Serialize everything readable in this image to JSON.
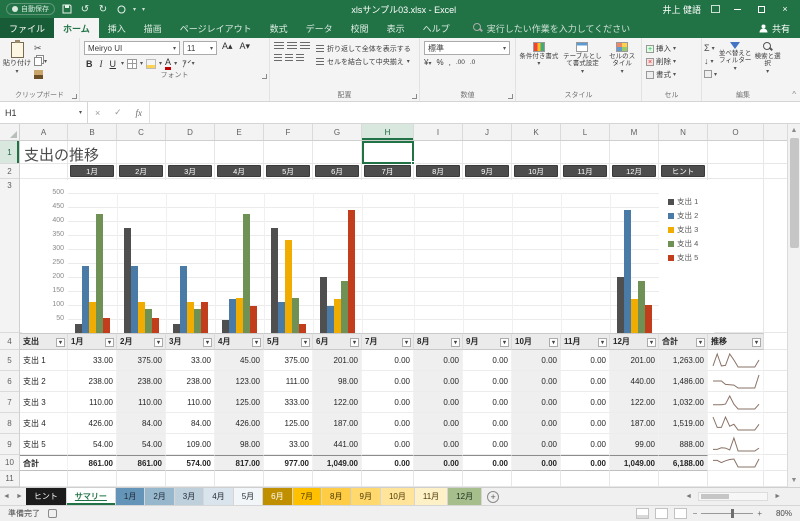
{
  "colors": {
    "accent": "#217346",
    "slicer": "#4d4d4d",
    "sparkline": "#8a7265"
  },
  "titlebar": {
    "autosave": "自動保存",
    "title": "xlsサンプル03.xlsx - Excel",
    "user": "井上 健語"
  },
  "ribbon": {
    "tabs": [
      "ファイル",
      "ホーム",
      "挿入",
      "描画",
      "ページレイアウト",
      "数式",
      "データ",
      "校閲",
      "表示",
      "ヘルプ"
    ],
    "active_tab": "ホーム",
    "search_label": "実行したい作業を入力してください",
    "share_label": "共有",
    "clipboard": {
      "paste": "貼り付け",
      "label": "クリップボード"
    },
    "font": {
      "name": "Meiryo UI",
      "size": "11",
      "label": "フォント"
    },
    "alignment": {
      "wrap": "折り返して全体を表示する",
      "merge": "セルを結合して中央揃え",
      "label": "配置"
    },
    "number": {
      "format": "標準",
      "label": "数値"
    },
    "styles": {
      "conditional": "条件付き書式",
      "table": "テーブルとして書式設定",
      "cell": "セルのスタイル",
      "label": "スタイル"
    },
    "cells": {
      "insert": "挿入",
      "delete": "削除",
      "format": "書式",
      "label": "セル"
    },
    "editing": {
      "sort": "並べ替えとフィルター",
      "find": "検索と選択",
      "label": "編集"
    }
  },
  "formula_bar": {
    "name_box": "H1",
    "formula": ""
  },
  "grid": {
    "columns": [
      "A",
      "B",
      "C",
      "D",
      "E",
      "F",
      "G",
      "H",
      "I",
      "J",
      "K",
      "L",
      "M",
      "N",
      "O"
    ],
    "selected_column": "H",
    "selected_cell": "H1",
    "rows": [
      "1",
      "2",
      "3",
      "4",
      "5",
      "6",
      "7",
      "8",
      "9",
      "10",
      "11"
    ]
  },
  "sheet": {
    "title": "支出の推移",
    "slicer_buttons": [
      "1月",
      "2月",
      "3月",
      "4月",
      "5月",
      "6月",
      "7月",
      "8月",
      "9月",
      "10月",
      "11月",
      "12月",
      "ヒント"
    ]
  },
  "chart_data": {
    "type": "bar",
    "title": "支出の推移",
    "categories": [
      "1月",
      "2月",
      "3月",
      "4月",
      "5月",
      "6月",
      "7月",
      "8月",
      "9月",
      "10月",
      "11月",
      "12月"
    ],
    "series": [
      {
        "name": "支出 1",
        "color": "#4f4f4f",
        "values": [
          33,
          375,
          33,
          45,
          375,
          201,
          0,
          0,
          0,
          0,
          0,
          201
        ]
      },
      {
        "name": "支出 2",
        "color": "#4a7ba7",
        "values": [
          238,
          238,
          238,
          123,
          111,
          98,
          0,
          0,
          0,
          0,
          0,
          440
        ]
      },
      {
        "name": "支出 3",
        "color": "#f0ac00",
        "values": [
          110,
          110,
          110,
          125,
          333,
          122,
          0,
          0,
          0,
          0,
          0,
          122
        ]
      },
      {
        "name": "支出 4",
        "color": "#6f9155",
        "values": [
          426,
          84,
          84,
          426,
          125,
          187,
          0,
          0,
          0,
          0,
          0,
          187
        ]
      },
      {
        "name": "支出 5",
        "color": "#c23d1b",
        "values": [
          54,
          54,
          109,
          98,
          33,
          441,
          0,
          0,
          0,
          0,
          0,
          99
        ]
      }
    ],
    "ylim": [
      0,
      500
    ],
    "yticks": [
      50,
      100,
      150,
      200,
      250,
      300,
      350,
      400,
      450,
      500
    ],
    "grid": true,
    "legend_position": "right"
  },
  "table": {
    "header": [
      "支出",
      "1月",
      "2月",
      "3月",
      "4月",
      "5月",
      "6月",
      "7月",
      "8月",
      "9月",
      "10月",
      "11月",
      "12月",
      "合計",
      "推移"
    ],
    "rows": [
      {
        "label": "支出 1",
        "cells": [
          "33.00",
          "375.00",
          "33.00",
          "45.00",
          "375.00",
          "201.00",
          "0.00",
          "0.00",
          "0.00",
          "0.00",
          "0.00",
          "201.00"
        ],
        "total": "1,263.00"
      },
      {
        "label": "支出 2",
        "cells": [
          "238.00",
          "238.00",
          "238.00",
          "123.00",
          "111.00",
          "98.00",
          "0.00",
          "0.00",
          "0.00",
          "0.00",
          "0.00",
          "440.00"
        ],
        "total": "1,486.00"
      },
      {
        "label": "支出 3",
        "cells": [
          "110.00",
          "110.00",
          "110.00",
          "125.00",
          "333.00",
          "122.00",
          "0.00",
          "0.00",
          "0.00",
          "0.00",
          "0.00",
          "122.00"
        ],
        "total": "1,032.00"
      },
      {
        "label": "支出 4",
        "cells": [
          "426.00",
          "84.00",
          "84.00",
          "426.00",
          "125.00",
          "187.00",
          "0.00",
          "0.00",
          "0.00",
          "0.00",
          "0.00",
          "187.00"
        ],
        "total": "1,519.00"
      },
      {
        "label": "支出 5",
        "cells": [
          "54.00",
          "54.00",
          "109.00",
          "98.00",
          "33.00",
          "441.00",
          "0.00",
          "0.00",
          "0.00",
          "0.00",
          "0.00",
          "99.00"
        ],
        "total": "888.00"
      }
    ],
    "total_row": {
      "label": "合計",
      "cells": [
        "861.00",
        "861.00",
        "574.00",
        "817.00",
        "977.00",
        "1,049.00",
        "0.00",
        "0.00",
        "0.00",
        "0.00",
        "0.00",
        "1,049.00"
      ],
      "total": "6,188.00"
    }
  },
  "sheet_tabs": [
    {
      "label": "ヒント",
      "bg": "#1c1c1c",
      "fg": "#ffffff",
      "active": false
    },
    {
      "label": "サマリー",
      "bg": "#ffffff",
      "fg": "#217346",
      "active": true
    },
    {
      "label": "1月",
      "bg": "#6494b8",
      "fg": "#1f2a33",
      "active": false
    },
    {
      "label": "2月",
      "bg": "#96b7cc",
      "fg": "#1f2a33",
      "active": false
    },
    {
      "label": "3月",
      "bg": "#bdd0dc",
      "fg": "#1f2a33",
      "active": false
    },
    {
      "label": "4月",
      "bg": "#d9e4ec",
      "fg": "#1f2a33",
      "active": false
    },
    {
      "label": "5月",
      "bg": "#f3f6f8",
      "fg": "#1f2a33",
      "active": false
    },
    {
      "label": "6月",
      "bg": "#bf8f00",
      "fg": "#ffffff",
      "active": false
    },
    {
      "label": "7月",
      "bg": "#ffc000",
      "fg": "#4a3800",
      "active": false
    },
    {
      "label": "8月",
      "bg": "#ffcd45",
      "fg": "#4a3800",
      "active": false
    },
    {
      "label": "9月",
      "bg": "#ffd96e",
      "fg": "#4a3800",
      "active": false
    },
    {
      "label": "10月",
      "bg": "#ffe49a",
      "fg": "#4a3800",
      "active": false
    },
    {
      "label": "11月",
      "bg": "#fff1c7",
      "fg": "#4a3800",
      "active": false
    },
    {
      "label": "12月",
      "bg": "#a6bd8c",
      "fg": "#203020",
      "active": false
    }
  ],
  "status_bar": {
    "ready": "準備完了",
    "zoom": "80%"
  }
}
